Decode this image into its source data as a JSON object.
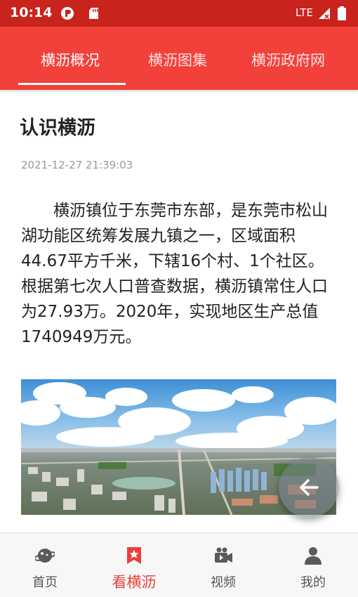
{
  "status_bar": {
    "time": "10:14",
    "network": "LTE",
    "icons": [
      "app-notification-icon",
      "sd-card-icon",
      "signal-icon",
      "battery-icon"
    ]
  },
  "tabs": [
    {
      "label": "横沥概况",
      "active": true
    },
    {
      "label": "横沥图集",
      "active": false
    },
    {
      "label": "横沥政府网",
      "active": false
    }
  ],
  "article": {
    "title": "认识横沥",
    "date": "2021-12-27 21:39:03",
    "body": "横沥镇位于东莞市东部，是东莞市松山湖功能区统筹发展九镇之一，区域面积44.67平方千米，下辖16个村、1个社区。根据第七次人口普查数据，横沥镇常住人口为27.93万。2020年，实现地区生产总值1740949万元。"
  },
  "bottom_nav": [
    {
      "label": "首页",
      "icon": "planet-icon",
      "active": false
    },
    {
      "label": "看横沥",
      "icon": "bookmark-star-icon",
      "active": true
    },
    {
      "label": "视频",
      "icon": "video-camera-icon",
      "active": false
    },
    {
      "label": "我的",
      "icon": "user-icon",
      "active": false
    }
  ],
  "colors": {
    "status_bar": "#c8231c",
    "tab_bar": "#f2413a",
    "accent": "#e8403a",
    "nav_inactive": "#555555"
  }
}
